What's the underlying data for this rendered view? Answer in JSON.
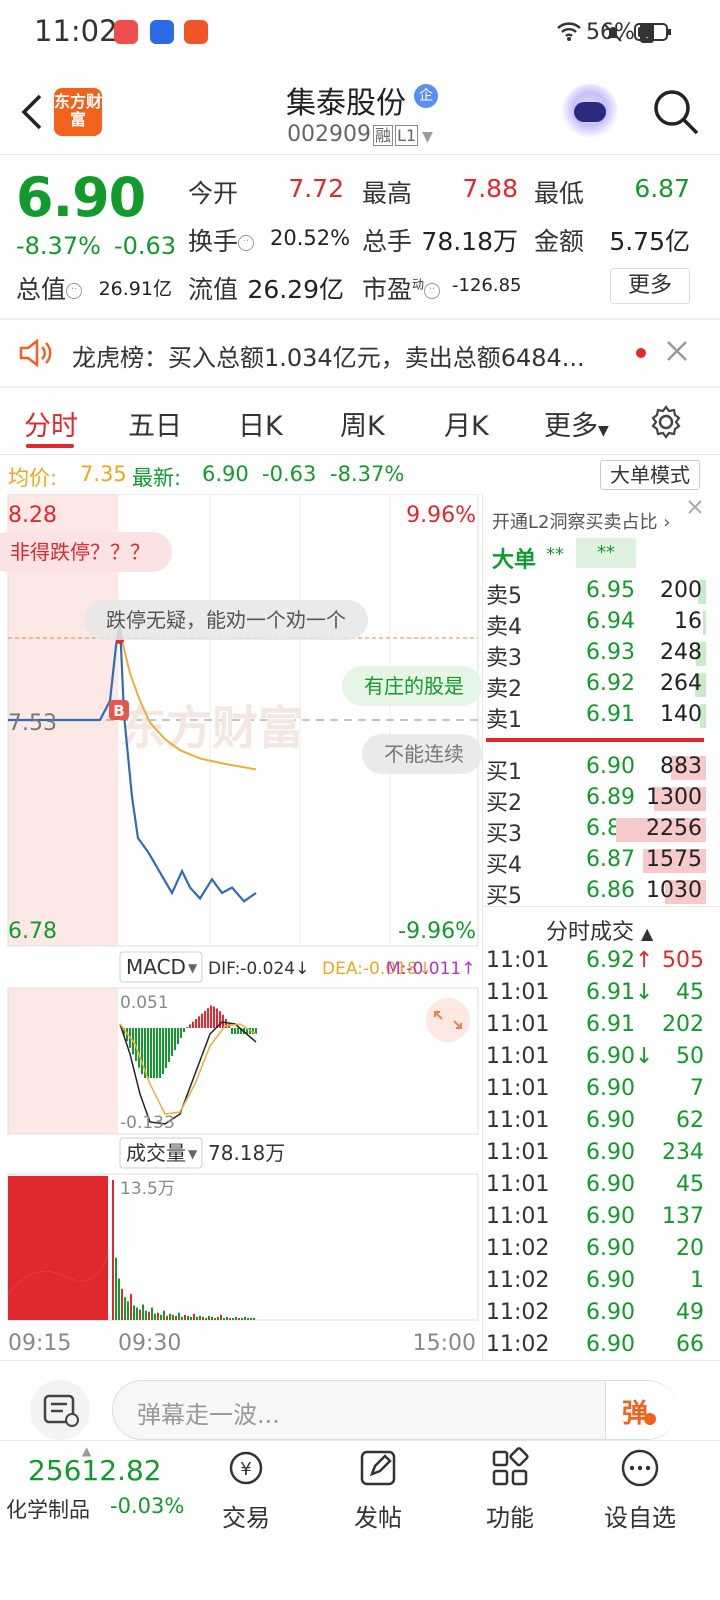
{
  "status_bar": {
    "time": "11:02",
    "battery": "56%"
  },
  "header": {
    "logo_text": "东方财富",
    "title": "集泰股份",
    "badge": "企",
    "code": "002909",
    "tag_rong": "融",
    "tag_l1": "L1"
  },
  "quote": {
    "price": "6.90",
    "pct": "-8.37%",
    "chg": "-0.63",
    "open_label": "今开",
    "open": "7.72",
    "high_label": "最高",
    "high": "7.88",
    "low_label": "最低",
    "low": "6.87",
    "turnover_label": "换手",
    "turnover": "20.52%",
    "volume_label": "总手",
    "volume": "78.18万",
    "amount_label": "金额",
    "amount": "5.75亿",
    "mktcap_label": "总值",
    "mktcap": "26.91亿",
    "float_label": "流值",
    "float": "26.29亿",
    "pe_label": "市盈",
    "pe_sup": "动",
    "pe": "-126.85",
    "more": "更多"
  },
  "notice": {
    "text": "龙虎榜：买入总额1.034亿元，卖出总额6484..."
  },
  "tabs": [
    "分时",
    "五日",
    "日K",
    "周K",
    "月K",
    "更多"
  ],
  "info": {
    "avg_label": "均价:",
    "avg": "7.35",
    "latest_label": "最新:",
    "latest": "6.90",
    "chg": "-0.63",
    "pct": "-8.37%",
    "mode_btn": "大单模式"
  },
  "chart": {
    "y_top": "8.28",
    "y_mid": "7.53",
    "y_bot": "6.78",
    "pct_top": "9.96%",
    "pct_bot": "-9.96%",
    "watermark": "东方财富",
    "b_marker": "B",
    "macd_label": "MACD",
    "dif": "DIF:-0.024↓",
    "dea": "DEA:-0.018↓",
    "m": "M:-0.011↑",
    "macd_top": "0.051",
    "macd_bot": "-0.133",
    "vol_label": "成交量",
    "vol_total": "78.18万",
    "vol_max": "13.5万",
    "t_start": "09:15",
    "t_mid": "09:30",
    "t_end": "15:00"
  },
  "chart_data": {
    "type": "line",
    "series": [
      {
        "name": "最新",
        "values": [
          7.53,
          7.53,
          7.53,
          7.53,
          7.6,
          7.8,
          7.88,
          7.55,
          7.4,
          7.25,
          7.1,
          7.05,
          7.0,
          6.95,
          6.9,
          6.98,
          6.92,
          6.88,
          6.95,
          6.9,
          6.92,
          6.87,
          6.9
        ]
      },
      {
        "name": "均价",
        "values": [
          7.85,
          7.7,
          7.6,
          7.52,
          7.46,
          7.42,
          7.39,
          7.37,
          7.35
        ]
      }
    ],
    "ylim": [
      6.78,
      8.28
    ]
  },
  "danmu": [
    "非得跌停？？？",
    "跌停无疑，能劝一个劝一个",
    "有庄的股是",
    "不能连续"
  ],
  "orderbook": {
    "l2_tip": "开通L2洞察买卖占比",
    "big_label": "大单",
    "big_val": "**",
    "big_val2": "**",
    "asks": [
      {
        "n": "卖5",
        "p": "6.95",
        "v": "200"
      },
      {
        "n": "卖4",
        "p": "6.94",
        "v": "16"
      },
      {
        "n": "卖3",
        "p": "6.93",
        "v": "248"
      },
      {
        "n": "卖2",
        "p": "6.92",
        "v": "264"
      },
      {
        "n": "卖1",
        "p": "6.91",
        "v": "140"
      }
    ],
    "bids": [
      {
        "n": "买1",
        "p": "6.90",
        "v": "883"
      },
      {
        "n": "买2",
        "p": "6.89",
        "v": "1300"
      },
      {
        "n": "买3",
        "p": "6.88",
        "v": "2256"
      },
      {
        "n": "买4",
        "p": "6.87",
        "v": "1575"
      },
      {
        "n": "买5",
        "p": "6.86",
        "v": "1030"
      }
    ]
  },
  "trades": {
    "title": "分时成交",
    "rows": [
      {
        "t": "11:01",
        "p": "6.92↑",
        "v": "505"
      },
      {
        "t": "11:01",
        "p": "6.91↓",
        "v": "45"
      },
      {
        "t": "11:01",
        "p": "6.91",
        "v": "202"
      },
      {
        "t": "11:01",
        "p": "6.90↓",
        "v": "50"
      },
      {
        "t": "11:01",
        "p": "6.90",
        "v": "7"
      },
      {
        "t": "11:01",
        "p": "6.90",
        "v": "62"
      },
      {
        "t": "11:01",
        "p": "6.90",
        "v": "234"
      },
      {
        "t": "11:01",
        "p": "6.90",
        "v": "45"
      },
      {
        "t": "11:01",
        "p": "6.90",
        "v": "137"
      },
      {
        "t": "11:02",
        "p": "6.90",
        "v": "20"
      },
      {
        "t": "11:02",
        "p": "6.90",
        "v": "1"
      },
      {
        "t": "11:02",
        "p": "6.90",
        "v": "49"
      },
      {
        "t": "11:02",
        "p": "6.90",
        "v": "66"
      }
    ]
  },
  "comment": {
    "placeholder": "弹幕走一波...",
    "danmu_btn": "弹"
  },
  "bottom": {
    "index_value": "25612.82",
    "index_name": "化学制品",
    "index_pct": "-0.03%",
    "nav": [
      "交易",
      "发帖",
      "功能",
      "设自选"
    ]
  }
}
